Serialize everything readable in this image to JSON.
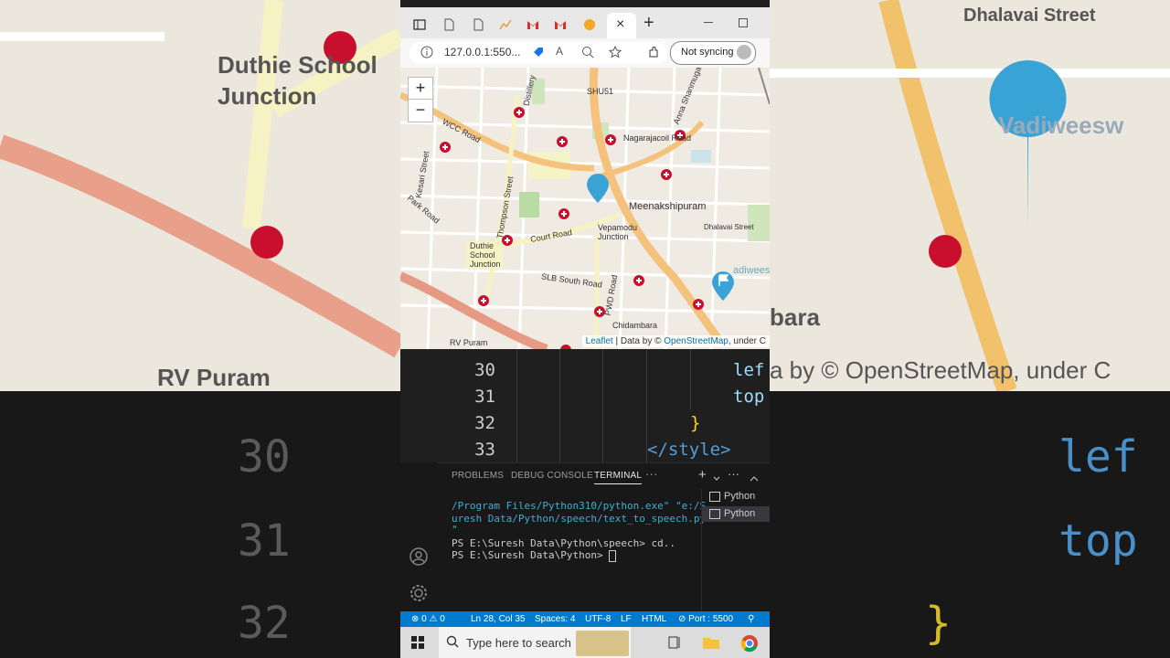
{
  "browser": {
    "url": "127.0.0.1:550...",
    "sync_label": "Not syncing",
    "new_tab_symbol": "+",
    "close_tab_symbol": "×"
  },
  "map": {
    "zoom_in": "+",
    "zoom_out": "−",
    "attribution": {
      "leaflet": "Leaflet",
      "sep": " | Data by © ",
      "osm": "OpenStreetMap",
      "tail": ", under C"
    },
    "labels": {
      "shu51": "SHU51",
      "wcc_road": "WCC Road",
      "distillery": "Distillery",
      "nagarajacoil": "Nagarajacoil Road",
      "anna_shanmugam": "Anna Shanmugam",
      "kesari": "Kesari Street",
      "park_road": "Park Road",
      "thompson": "Thompson Street",
      "meenakshipuram": "Meenakshipuram",
      "dhalavai": "Dhalavai Street",
      "vepamodu": "Vepamodu Junction",
      "court_road": "Court Road",
      "duthie": "Duthie School Junction",
      "vadiweesw": "adiweesw",
      "slb_south": "SLB South Road",
      "pwd_road": "PWD Road",
      "chidambara": "Chidambara",
      "rv_puram": "RV Puram"
    }
  },
  "editor": {
    "lines": [
      {
        "num": "30",
        "code": "lef"
      },
      {
        "num": "31",
        "code": "top"
      },
      {
        "num": "32",
        "code": "}"
      },
      {
        "num": "33",
        "code": "</style>"
      }
    ]
  },
  "panel": {
    "tabs": [
      "PROBLEMS",
      "DEBUG CONSOLE",
      "TERMINAL"
    ],
    "more": "···",
    "terminal_lines": [
      "/Program Files/Python310/python.exe\" \"e:/S",
      "uresh Data/Python/speech/text_to_speech.py",
      "\"",
      "",
      "PS E:\\Suresh Data\\Python\\speech> cd..",
      "PS E:\\Suresh Data\\Python> "
    ],
    "terminals": [
      "Python",
      "Python"
    ]
  },
  "status": {
    "errors": "0",
    "warnings": "0",
    "position": "Ln 28, Col 35",
    "spaces": "Spaces: 4",
    "encoding": "UTF-8",
    "eol": "LF",
    "language": "HTML",
    "port": "Port : 5500"
  },
  "taskbar": {
    "search_placeholder": "Type here to search"
  },
  "background": {
    "left_labels": {
      "duthie": "Duthie School Junction",
      "rv_puram": "RV Puram"
    },
    "right_labels": {
      "dhalavai": "Dhalavai Street",
      "osm": "a by © OpenStreetMap, under C",
      "bara": "bara",
      "vadiw": "Vadiweesw"
    },
    "left_line_nums": [
      "30",
      "31",
      "32"
    ],
    "right_code": [
      "lef",
      "top",
      "}"
    ]
  },
  "colors": {
    "accent": "#007acc",
    "marker": "#3aa3d6",
    "hospital": "#c8102e"
  }
}
